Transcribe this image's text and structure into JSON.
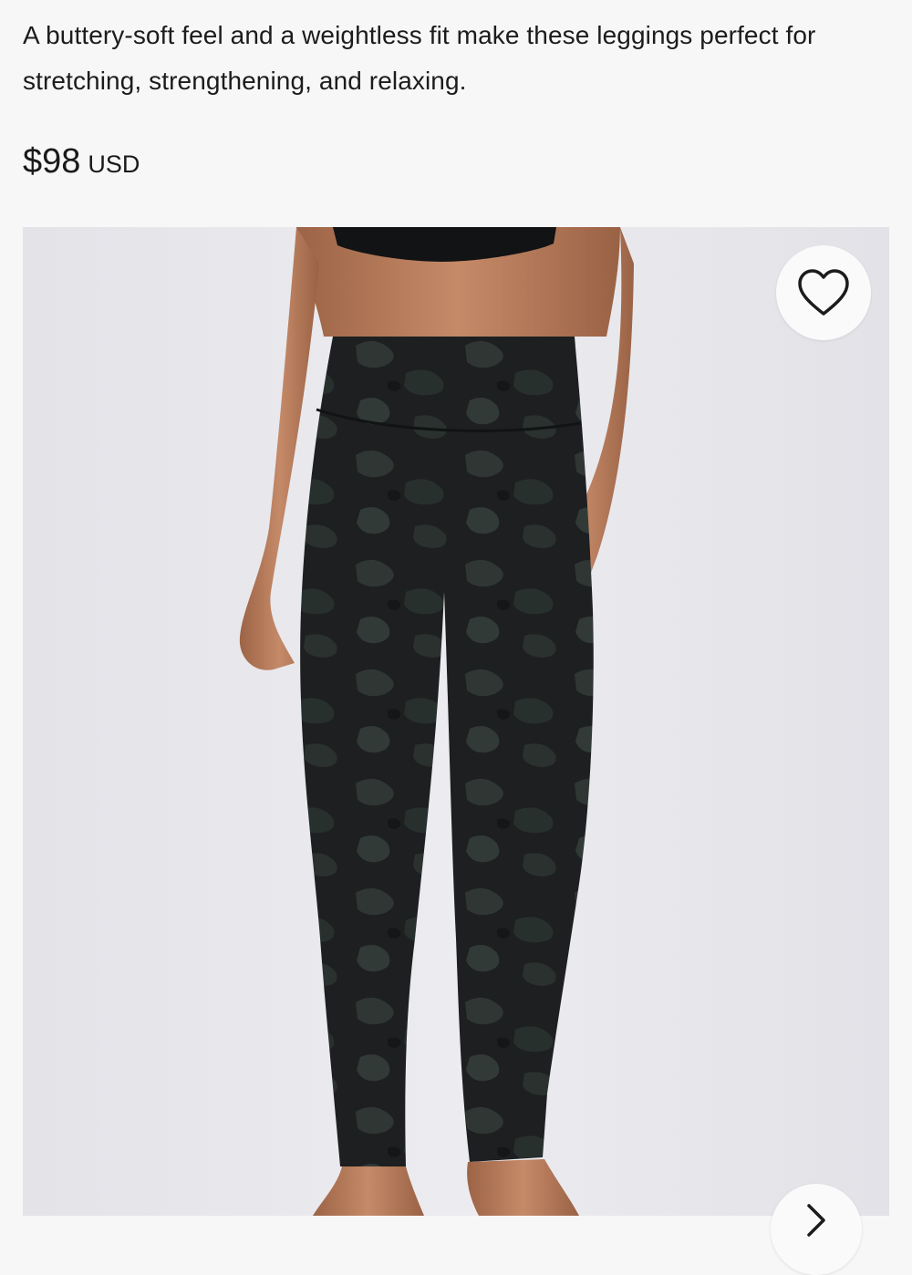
{
  "product": {
    "description": "A buttery-soft feel and a weightless fit make these leggings perfect for stretching, strengthening, and relaxing.",
    "price": "$98",
    "currency": "USD"
  },
  "gallery": {
    "image_subject": "leggings-model-photo",
    "favorite_icon": "heart-outline-icon",
    "next_icon": "chevron-right-icon"
  },
  "colors": {
    "background": "#f7f7f7",
    "photo_background": "#e6e6ea",
    "legging": "#1e2022",
    "camo": "#2e3432",
    "skin": "#b98060"
  }
}
